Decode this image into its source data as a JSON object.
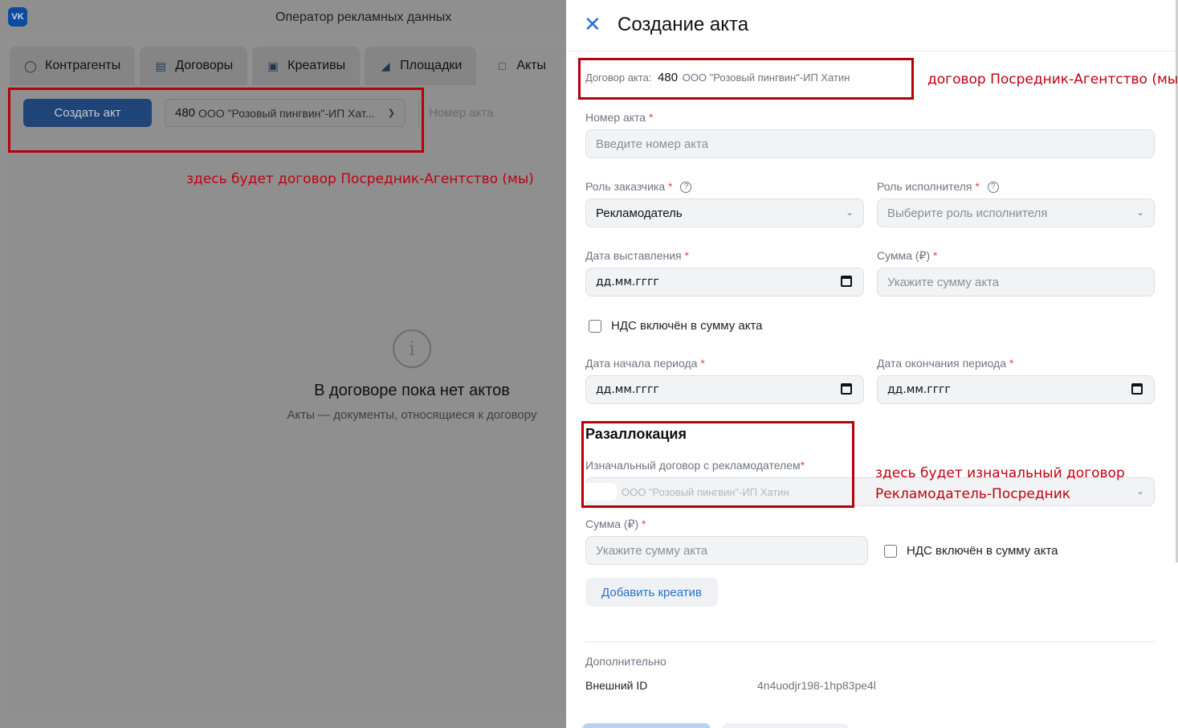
{
  "app": {
    "logo": "VK",
    "title": "Оператор рекламных данных",
    "tabs": [
      {
        "label": "Контрагенты",
        "icon": "user-icon"
      },
      {
        "label": "Договоры",
        "icon": "book-icon"
      },
      {
        "label": "Креативы",
        "icon": "window-icon"
      },
      {
        "label": "Площадки",
        "icon": "megaphone-icon"
      },
      {
        "label": "Акты",
        "icon": "document-icon"
      }
    ],
    "toolbar": {
      "create_label": "Создать акт",
      "contract_num": "480",
      "contract_name": "ООО \"Розовый пингвин\"-ИП Хат...",
      "act_number_placeholder": "Номер акта"
    },
    "empty": {
      "title": "В договоре пока нет актов",
      "subtitle": "Акты — документы, относящиеся к договору"
    }
  },
  "drawer": {
    "title": "Создание акта",
    "contract": {
      "label": "Договор акта:",
      "num": "480",
      "name": "ООО \"Розовый пингвин\"-ИП Хатин"
    },
    "act_number": {
      "label": "Номер акта",
      "required": "*",
      "placeholder": "Введите номер акта"
    },
    "customer_role": {
      "label": "Роль заказчика",
      "required": "*",
      "value": "Рекламодатель"
    },
    "executor_role": {
      "label": "Роль исполнителя",
      "required": "*",
      "placeholder": "Выберите роль исполнителя"
    },
    "issue_date": {
      "label": "Дата выставления",
      "required": "*",
      "value": "дд.мм.гггг"
    },
    "amount": {
      "label": "Сумма (₽)",
      "required": "*",
      "placeholder": "Укажите сумму акта"
    },
    "vat_label": "НДС включён в сумму акта",
    "period_start": {
      "label": "Дата начала периода",
      "required": "*",
      "value": "дд.мм.гггг"
    },
    "period_end": {
      "label": "Дата окончания периода",
      "required": "*",
      "value": "дд.мм.гггг"
    },
    "reallocation": {
      "title": "Разаллокация",
      "original_label": "Изначальный договор с рекламодателем",
      "required": "*",
      "original_value": "ООО \"Розовый пингвин\"-ИП Хатин",
      "amount_label": "Сумма (₽)",
      "amount_placeholder": "Укажите сумму акта",
      "vat_label": "НДС включён в сумму акта",
      "add_creative": "Добавить креатив"
    },
    "extra": {
      "section_label": "Дополнительно",
      "external_id_label": "Внешний ID",
      "external_id_value": "4n4uodjr198-1hp83pe4l"
    }
  },
  "annotations": {
    "toolbar_note": "здесь будет договор Посредник-Агентство (мы)",
    "contract_note": "договор Посредник-Агентство (мы)",
    "original_note_line1": "здесь будет изначальный договор",
    "original_note_line2": "Рекламодатель-Посредник"
  },
  "colors": {
    "accent": "#2874d0",
    "annotation": "#c00010",
    "required": "#e64646"
  }
}
